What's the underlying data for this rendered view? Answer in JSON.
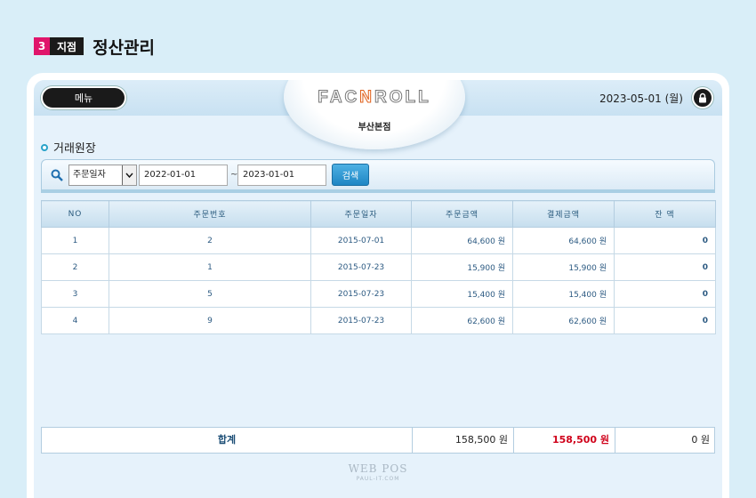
{
  "page_header": {
    "step_number": "3",
    "step_tag": "지점",
    "title": "정산관리"
  },
  "app": {
    "menu_label": "메뉴",
    "logo_prefix": "FAC",
    "logo_accent": "N",
    "logo_suffix": "ROLL",
    "branch": "부산본점",
    "date": "2023-05-01 (월)"
  },
  "section": {
    "title": "거래원장"
  },
  "search": {
    "select_value": "주문일자",
    "start_date": "2022-01-01",
    "tilde": "~",
    "end_date": "2023-01-01",
    "button_label": "검색"
  },
  "table": {
    "headers": [
      "NO",
      "주문번호",
      "주문일자",
      "주문금액",
      "결제금액",
      "잔 액"
    ],
    "rows": [
      [
        "1",
        "2",
        "2015-07-01",
        "64,600 원",
        "64,600 원",
        "0"
      ],
      [
        "2",
        "1",
        "2015-07-23",
        "15,900 원",
        "15,900 원",
        "0"
      ],
      [
        "3",
        "5",
        "2015-07-23",
        "15,400 원",
        "15,400 원",
        "0"
      ],
      [
        "4",
        "9",
        "2015-07-23",
        "62,600 원",
        "62,600 원",
        "0"
      ]
    ]
  },
  "totals": {
    "label": "합계",
    "order_amount": "158,500 원",
    "paid_amount": "158,500 원",
    "balance": "0 원"
  },
  "watermark": {
    "line1": "WEB POS",
    "line2": "PAUL-IT.COM"
  },
  "colors": {
    "accent_pink": "#e0156b",
    "button_blue": "#1f86c4",
    "paid_red": "#d0021b",
    "header_text": "#2a5b7e"
  }
}
